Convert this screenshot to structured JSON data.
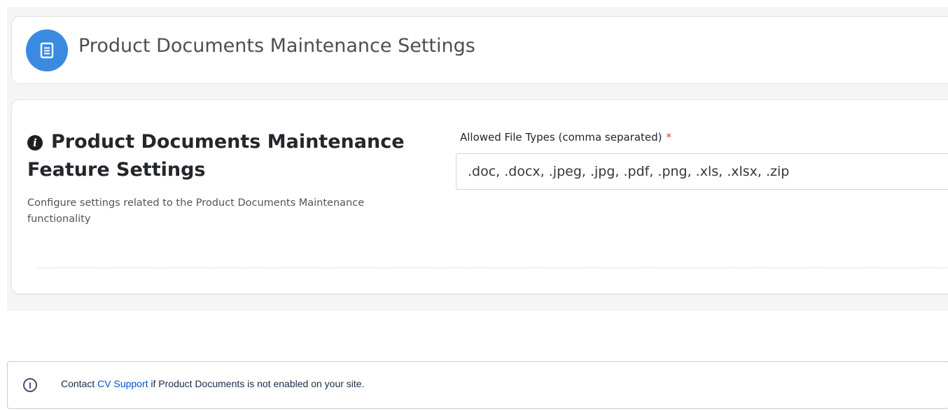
{
  "header": {
    "title": "Product Documents Maintenance Settings",
    "icon": "document-icon",
    "icon_color": "#3a8be0"
  },
  "feature_settings": {
    "title": "Product Documents Maintenance Feature Settings",
    "title_icon": "info-circle-icon",
    "description": "Configure settings related to the Product Documents Maintenance functionality",
    "allowed_file_types": {
      "label": "Allowed File Types (comma separated)",
      "required_marker": "*",
      "value": ".doc, .docx, .jpeg, .jpg, .pdf, .png, .xls, .xlsx, .zip"
    }
  },
  "info_panel": {
    "icon": "info-icon",
    "text_before": "Contact ",
    "link_text": "CV Support",
    "text_after": " if Product Documents is not enabled on your site."
  },
  "colors": {
    "accent": "#3a8be0",
    "required": "#d2402f",
    "link": "#0052cc"
  }
}
